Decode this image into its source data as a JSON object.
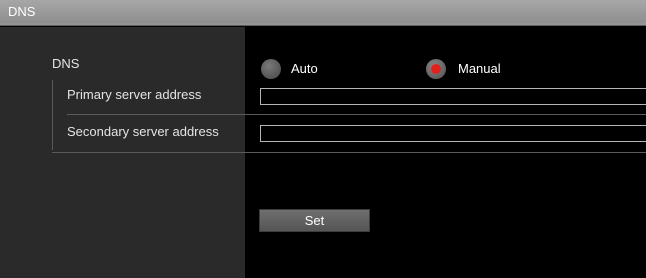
{
  "header": {
    "title": "DNS"
  },
  "dns": {
    "label": "DNS",
    "mode_options": [
      {
        "label": "Auto",
        "selected": false
      },
      {
        "label": "Manual",
        "selected": true
      }
    ],
    "primary": {
      "label": "Primary server address",
      "value": ""
    },
    "secondary": {
      "label": "Secondary server address",
      "value": ""
    }
  },
  "actions": {
    "set_label": "Set"
  },
  "colors": {
    "selected_dot": "#e0221b",
    "left_panel_bg": "#2a2a2a",
    "header_bg": "#8f8f8f"
  }
}
